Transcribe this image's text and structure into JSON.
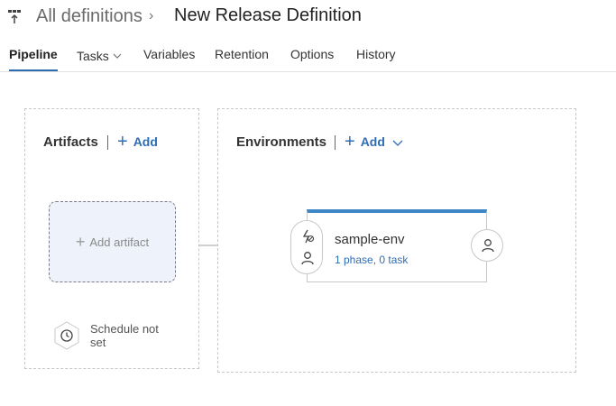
{
  "header": {
    "app_icon": "release-pipeline-icon",
    "breadcrumb_parent": "All definitions",
    "breadcrumb_separator": "›",
    "title": "New Release Definition"
  },
  "tabs": [
    {
      "label": "Pipeline",
      "active": true
    },
    {
      "label": "Tasks",
      "has_dropdown": true
    },
    {
      "label": "Variables"
    },
    {
      "label": "Retention"
    },
    {
      "label": "Options"
    },
    {
      "label": "History"
    }
  ],
  "artifacts": {
    "title": "Artifacts",
    "add_label": "Add",
    "add_artifact_label": "Add artifact",
    "schedule_label": "Schedule not set",
    "schedule_icon": "clock-icon"
  },
  "environments": {
    "title": "Environments",
    "add_label": "Add",
    "environment": {
      "name": "sample-env",
      "summary": "1 phase, 0 task",
      "pre_deployment_icons": [
        "trigger-icon",
        "person-icon"
      ],
      "post_deployment_icon": "person-icon"
    }
  },
  "colors": {
    "accent": "#2e6db4",
    "environment_bar": "#3f86c6",
    "artifact_fill": "#eef2fa"
  }
}
